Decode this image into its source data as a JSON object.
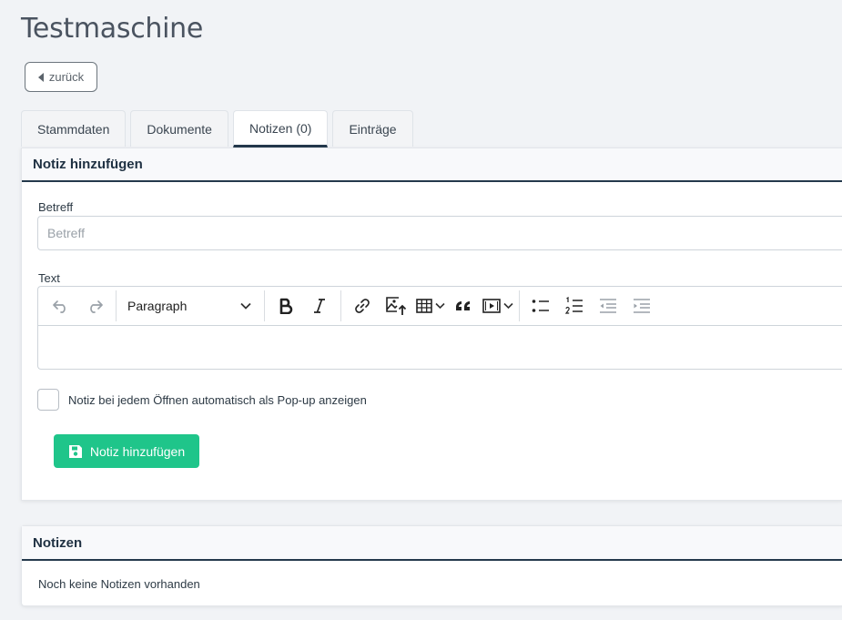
{
  "page": {
    "title": "Testmaschine"
  },
  "back_button": {
    "label": "zurück"
  },
  "tabs": [
    {
      "label": "Stammdaten",
      "active": false
    },
    {
      "label": "Dokumente",
      "active": false
    },
    {
      "label": "Notizen (0)",
      "active": true
    },
    {
      "label": "Einträge",
      "active": false
    }
  ],
  "add_note": {
    "header": "Notiz hinzufügen",
    "subject_label": "Betreff",
    "subject_placeholder": "Betreff",
    "subject_value": "",
    "text_label": "Text",
    "paragraph_select": "Paragraph",
    "popup_checkbox_label": "Notiz bei jedem Öffnen automatisch als Pop-up anzeigen",
    "popup_checked": false,
    "submit_label": "Notiz hinzufügen"
  },
  "notes": {
    "header": "Notizen",
    "empty_text": "Noch keine Notizen vorhanden"
  },
  "colors": {
    "accent_dark": "#24394c",
    "submit_green": "#1fc58a"
  }
}
